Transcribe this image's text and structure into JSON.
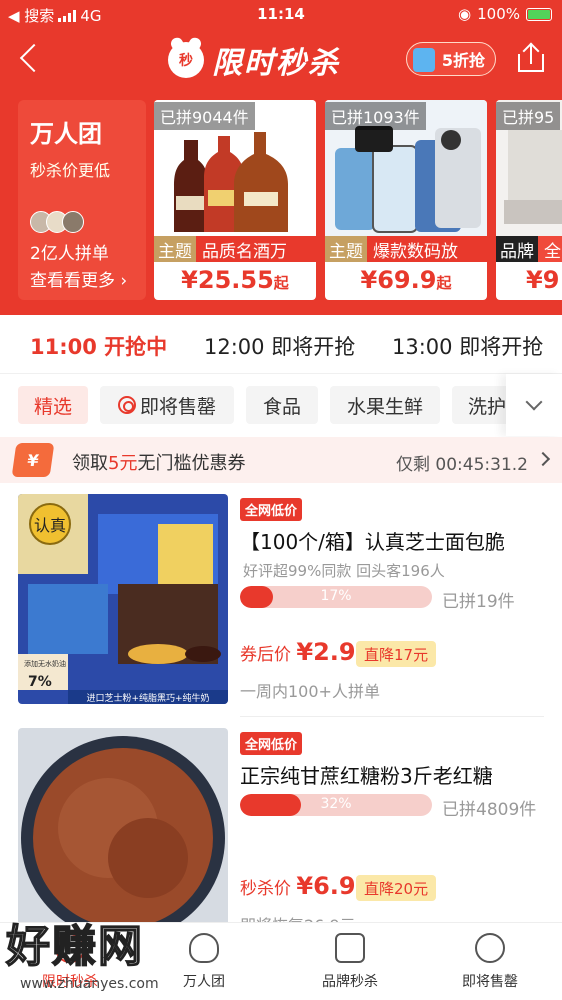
{
  "status": {
    "left": "◀ 搜索",
    "network": "4G",
    "time": "11:14",
    "battery": "100%"
  },
  "header": {
    "title": "限时秒杀",
    "clock_label": "秒",
    "half_label": "5折抢"
  },
  "group": {
    "title": "万人团",
    "subtitle": "秒杀价更低",
    "count": "2亿人拼单",
    "more": "查看看更多 ›"
  },
  "hero_cards": [
    {
      "tag": "已拼9044件",
      "label_key": "主题",
      "label": "品质名酒万",
      "price": "¥25.55",
      "suffix": "起"
    },
    {
      "tag": "已拼1093件",
      "label_key": "主题",
      "label": "爆款数码放",
      "price": "¥69.9",
      "suffix": "起"
    },
    {
      "tag": "已拼95",
      "label_key": "品牌",
      "label": "全",
      "price": "¥9",
      "suffix": ""
    }
  ],
  "tabs": [
    "11:00 开抢中",
    "12:00 即将开抢",
    "13:00 即将开抢"
  ],
  "categories": [
    "精选",
    "即将售罄",
    "食品",
    "水果生鲜",
    "洗护"
  ],
  "coupon": {
    "icon": "¥",
    "text_pre": "领取",
    "amount": "5元",
    "text_post": "无门槛优惠券",
    "remaining": "仅剩 00:45:31.2"
  },
  "items": [
    {
      "badge": "全网低价",
      "name": "【100个/箱】认真芝士面包脆",
      "sub": "好评超99%同款  回头客196人",
      "pct": "17%",
      "pct_value": 17,
      "sold": "已拼19件",
      "price_label": "券后价",
      "price": "¥2.9",
      "discount": "直降17元",
      "foot": "一周内100+人拼单",
      "brand": "认真",
      "pic_text": "7%",
      "pic_caption": "进口芝士粉+纯脂黑巧+纯牛奶",
      "pic_small": "添加无水奶油"
    },
    {
      "badge": "全网低价",
      "name": "正宗纯甘蔗红糖粉3斤老红糖",
      "sub": "",
      "pct": "32%",
      "pct_value": 32,
      "sold": "已拼4809件",
      "price_label": "秒杀价",
      "price": "¥6.9",
      "discount": "直降20元",
      "foot": "即将恢复26.9元"
    }
  ],
  "bottom_nav": [
    "限时秒杀",
    "万人团",
    "品牌秒杀",
    "即将售罄"
  ],
  "watermark": {
    "title": "好赚网",
    "url": "www.zhuanyes.com"
  }
}
